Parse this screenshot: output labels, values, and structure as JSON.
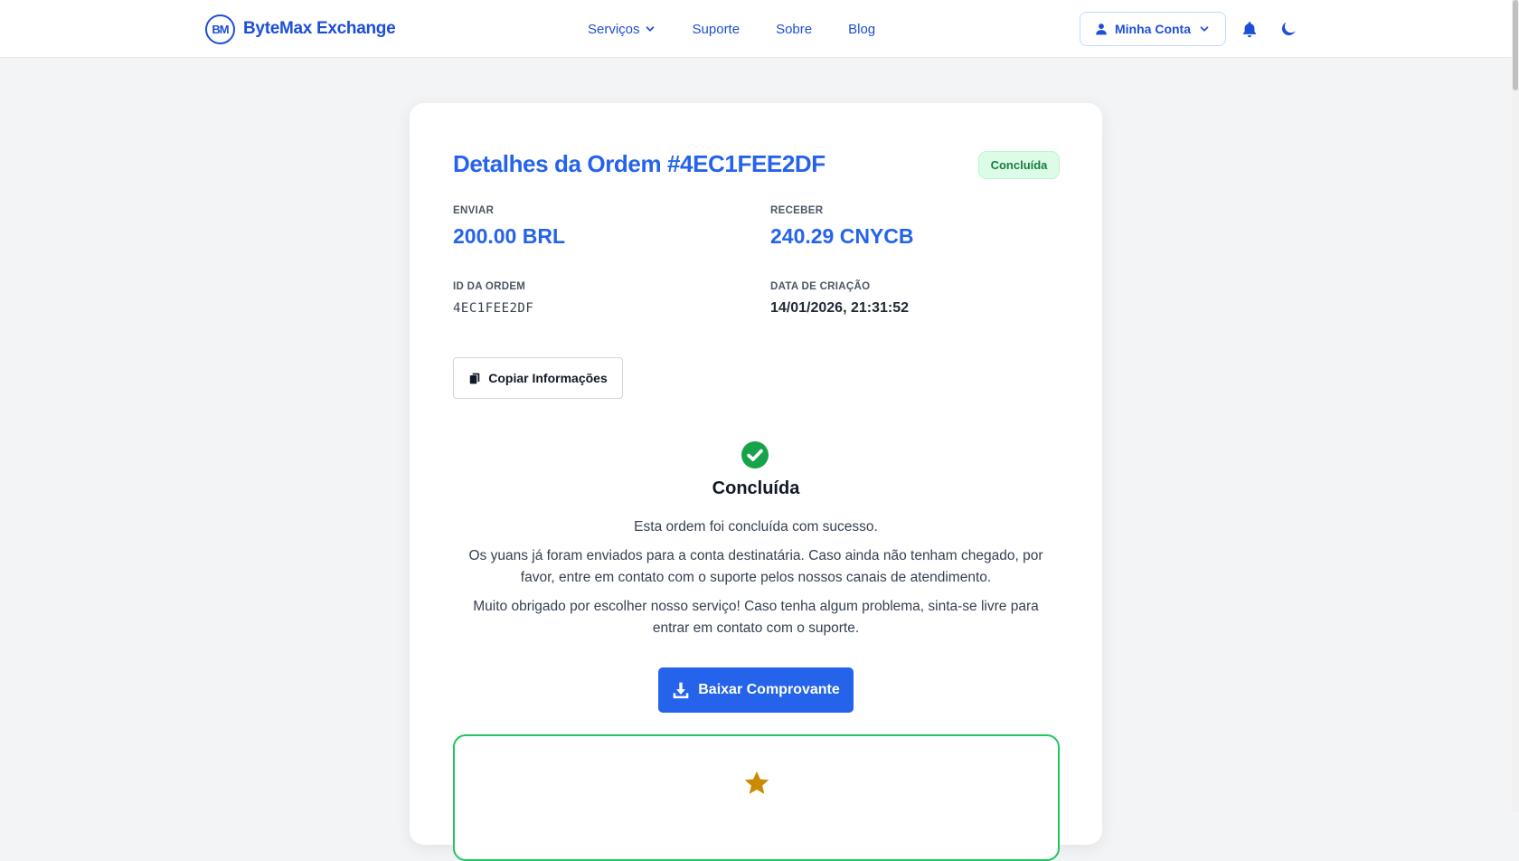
{
  "header": {
    "logo_mark": "BM",
    "logo_text": "ByteMax Exchange",
    "nav": [
      {
        "label": "Serviços",
        "has_dropdown": true
      },
      {
        "label": "Suporte"
      },
      {
        "label": "Sobre"
      },
      {
        "label": "Blog"
      }
    ],
    "account_label": "Minha Conta",
    "icons": [
      "user-icon",
      "chevron-down-icon",
      "bell-icon",
      "moon-icon"
    ]
  },
  "order": {
    "title": "Detalhes da Ordem #4EC1FEE2DF",
    "status_badge": "Concluída",
    "send_label": "ENVIAR",
    "send_value": "200.00 BRL",
    "receive_label": "RECEBER",
    "receive_value": "240.29 CNYCB",
    "id_label": "ID DA ORDEM",
    "id_value": "4EC1FEE2DF",
    "date_label": "DATA DE CRIAÇÃO",
    "date_value": "14/01/2026, 21:31:52",
    "copy_label": "Copiar Informações",
    "status_heading": "Concluída",
    "messages": [
      "Esta ordem foi concluída com sucesso.",
      "Os yuans já foram enviados para a conta destinatária. Caso ainda não tenham chegado, por favor, entre em contato com o suporte pelos nossos canais de atendimento.",
      "Muito obrigado por escolher nosso serviço! Caso tenha algum problema, sinta-se livre para entrar em contato com o suporte."
    ],
    "download_label": "Baixar Comprovante"
  },
  "colors": {
    "brand": "#1d4ed8",
    "primary": "#2563eb",
    "success": "#16a34a",
    "badge_bg": "#dcfce7",
    "star": "#ca8a04"
  }
}
